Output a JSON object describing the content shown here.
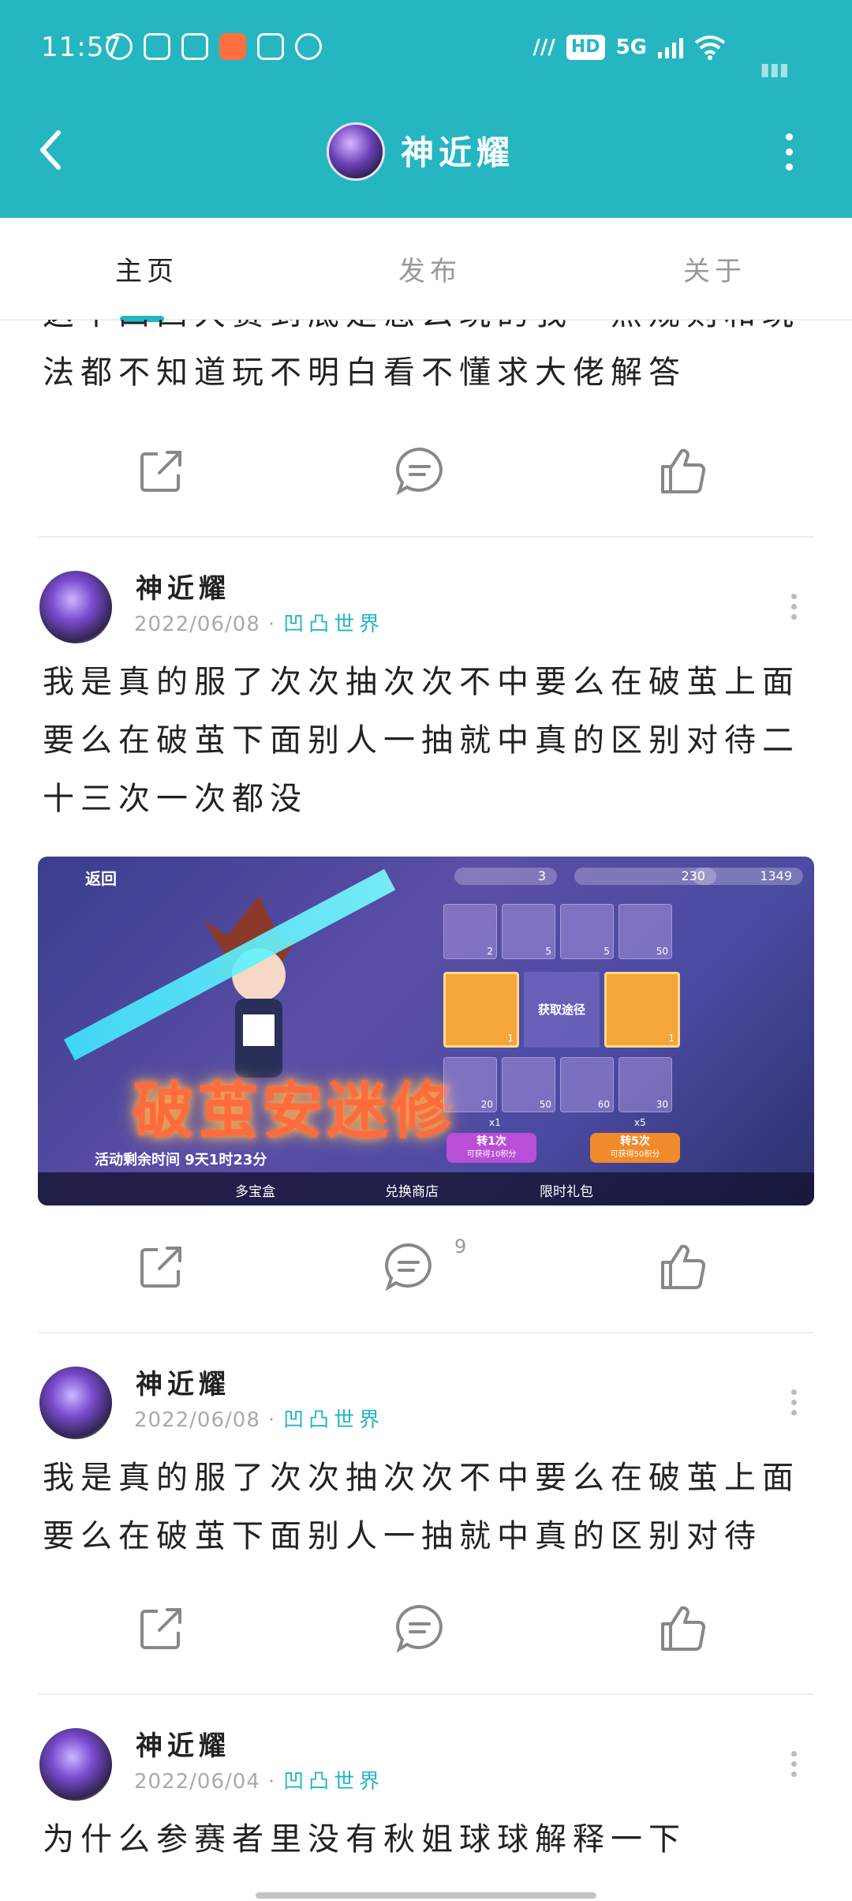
{
  "status_bar": {
    "time": "11:57",
    "hd": "HD",
    "network": "5G"
  },
  "header": {
    "title": "神近耀"
  },
  "tabs": [
    {
      "label": "主页"
    },
    {
      "label": "发布"
    },
    {
      "label": "关于"
    }
  ],
  "posts": [
    {
      "text": "这个凹凸大赛到底是怎么玩的我一点规则和玩法都不知道玩不明白看不懂求大佬解答"
    },
    {
      "author": "神近耀",
      "date": "2022/06/08",
      "category": "凹凸世界",
      "text": "我是真的服了次次抽次次不中要么在破茧上面要么在破茧下面别人一抽就中真的区别对待二十三次一次都没",
      "comment_count": "9",
      "image": {
        "back_label": "返回",
        "res1": "3",
        "res2": "230",
        "res3": "1349",
        "title": "破茧安迷修",
        "center_label": "获取途径",
        "timer": "活动剩余时间 9天1时23分",
        "spin1_label": "转1次",
        "spin1_sub": "可获得10积分",
        "spin1_cost": "x1",
        "spin5_label": "转5次",
        "spin5_sub": "可获得50积分",
        "spin5_cost": "x5",
        "bottom_tabs": [
          "多宝盒",
          "兑换商店",
          "限时礼包"
        ],
        "cell_counts": [
          "2",
          "5",
          "5",
          "50",
          "1",
          "1",
          "20",
          "50",
          "60",
          "30"
        ]
      }
    },
    {
      "author": "神近耀",
      "date": "2022/06/08",
      "category": "凹凸世界",
      "text": "我是真的服了次次抽次次不中要么在破茧上面要么在破茧下面别人一抽就中真的区别对待"
    },
    {
      "author": "神近耀",
      "date": "2022/06/04",
      "category": "凹凸世界",
      "text": "为什么参赛者里没有秋姐球球解释一下"
    }
  ],
  "colors": {
    "brand": "#25b6c2",
    "muted": "#999999"
  }
}
